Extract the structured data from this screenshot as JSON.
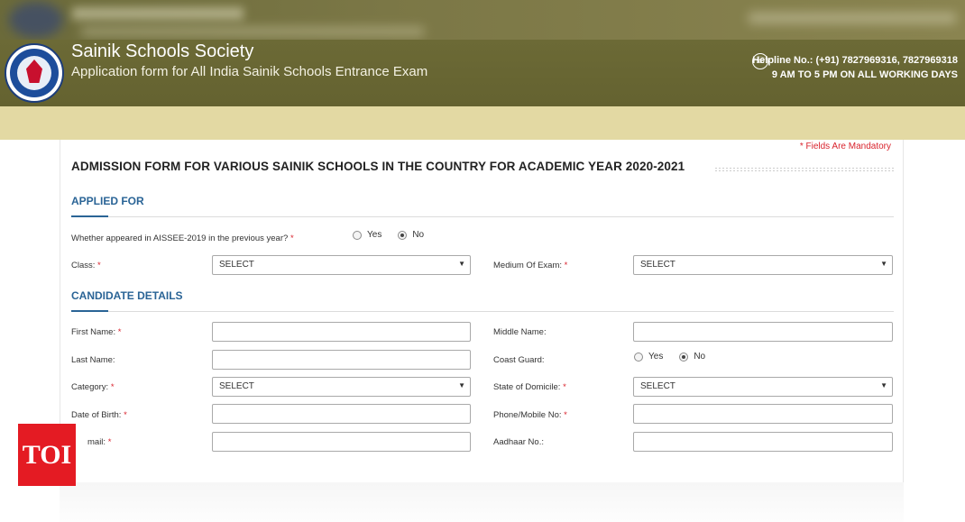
{
  "header": {
    "title": "Sainik Schools Society",
    "subtitle": "Application form for All India Sainik Schools Entrance Exam",
    "helpline": "Helpline No.: (+91) 7827969316, 7827969318",
    "hours": "9 AM TO 5 PM ON ALL WORKING DAYS",
    "phone_icon": "☏"
  },
  "form": {
    "mandatory_note": "* Fields Are Mandatory",
    "title": "ADMISSION FORM FOR VARIOUS SAINIK SCHOOLS IN THE COUNTRY FOR ACADEMIC YEAR 2020-2021",
    "required_mark": "*",
    "applied_for": {
      "heading": "APPLIED FOR",
      "aissee_question": "Whether appeared in AISSEE-2019 in the previous year?",
      "aissee_options": [
        "Yes",
        "No"
      ],
      "aissee_selected": "No",
      "class_label": "Class:",
      "class_value": "SELECT",
      "medium_label": "Medium Of Exam:",
      "medium_value": "SELECT"
    },
    "candidate": {
      "heading": "CANDIDATE DETAILS",
      "first_name_label": "First Name:",
      "middle_name_label": "Middle Name:",
      "last_name_label": "Last Name:",
      "coast_guard_label": "Coast Guard:",
      "coast_guard_options": [
        "Yes",
        "No"
      ],
      "coast_guard_selected": "No",
      "category_label": "Category:",
      "category_value": "SELECT",
      "domicile_label": "State of Domicile:",
      "domicile_value": "SELECT",
      "dob_label": "Date of Birth:",
      "phone_label": "Phone/Mobile No:",
      "email_label": "mail:",
      "aadhaar_label": "Aadhaar No.:"
    }
  },
  "watermark": {
    "text": "TOI"
  },
  "colors": {
    "header": "#6c6a36",
    "band": "#e3d9a3",
    "section": "#2a6496",
    "required": "#d9232d",
    "toi": "#e41b23"
  }
}
